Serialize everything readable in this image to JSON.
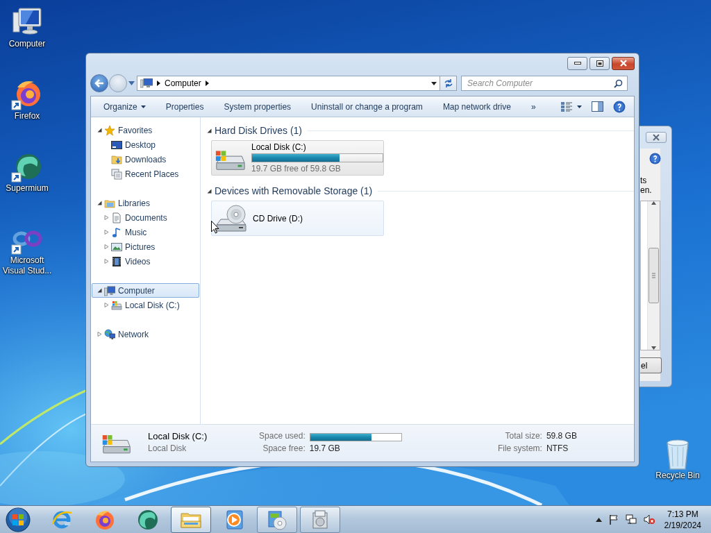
{
  "desktop_icons": [
    {
      "label": "Computer",
      "kind": "computer",
      "shortcut": false
    },
    {
      "label": "Firefox",
      "kind": "firefox",
      "shortcut": true
    },
    {
      "label": "Supermium",
      "kind": "supermium",
      "shortcut": true
    },
    {
      "label": "Microsoft Visual Stud...",
      "kind": "vs",
      "shortcut": true
    }
  ],
  "recycle_bin": {
    "label": "Recycle Bin"
  },
  "background_window": {
    "text_lines": [
      "ts",
      "en."
    ],
    "button": "el"
  },
  "explorer": {
    "address": {
      "crumbs": [
        "Computer"
      ]
    },
    "search": {
      "placeholder": "Search Computer"
    },
    "toolbar": [
      {
        "label": "Organize",
        "dropdown": true
      },
      {
        "label": "Properties",
        "dropdown": false
      },
      {
        "label": "System properties",
        "dropdown": false
      },
      {
        "label": "Uninstall or change a program",
        "dropdown": false
      },
      {
        "label": "Map network drive",
        "dropdown": false
      },
      {
        "label": "»",
        "dropdown": false
      }
    ],
    "sidebar": [
      {
        "label": "Favorites",
        "kind": "star",
        "expanded": true,
        "selected": false,
        "children": [
          {
            "label": "Desktop",
            "kind": "desktop",
            "selected": false
          },
          {
            "label": "Downloads",
            "kind": "downloads",
            "selected": false
          },
          {
            "label": "Recent Places",
            "kind": "recent",
            "selected": false
          }
        ]
      },
      {
        "label": "Libraries",
        "kind": "library",
        "expanded": true,
        "selected": false,
        "children": [
          {
            "label": "Documents",
            "kind": "document",
            "expanded": false,
            "selected": false
          },
          {
            "label": "Music",
            "kind": "music",
            "expanded": false,
            "selected": false
          },
          {
            "label": "Pictures",
            "kind": "pictures",
            "expanded": false,
            "selected": false
          },
          {
            "label": "Videos",
            "kind": "videos",
            "expanded": false,
            "selected": false
          }
        ]
      },
      {
        "label": "Computer",
        "kind": "computer",
        "expanded": true,
        "selected": true,
        "children": [
          {
            "label": "Local Disk (C:)",
            "kind": "drive",
            "expanded": false,
            "selected": false
          }
        ]
      },
      {
        "label": "Network",
        "kind": "network",
        "expanded": false,
        "selected": false
      }
    ],
    "groups": [
      {
        "title": "Hard Disk Drives (1)",
        "expanded": true,
        "items": [
          {
            "name": "Local Disk (C:)",
            "kind": "hdd",
            "selected": true,
            "level": 0.67,
            "detail": "19.7 GB free of 59.8 GB"
          }
        ]
      },
      {
        "title": "Devices with Removable Storage (1)",
        "expanded": true,
        "items": [
          {
            "name": "CD Drive (D:)",
            "kind": "cd",
            "selected": false
          }
        ]
      }
    ],
    "details": {
      "name": "Local Disk (C:)",
      "type": "Local Disk",
      "fields": [
        {
          "label": "Space used:",
          "kind": "bar",
          "level": 0.67
        },
        {
          "label": "Total size:",
          "kind": "text",
          "value": "59.8 GB"
        },
        {
          "label": "Space free:",
          "kind": "text",
          "value": "19.7 GB"
        },
        {
          "label": "File system:",
          "kind": "text",
          "value": "NTFS"
        }
      ]
    }
  },
  "taskbar": {
    "items": [
      {
        "kind": "ie",
        "running": false,
        "active": false
      },
      {
        "kind": "firefox",
        "running": false,
        "active": false
      },
      {
        "kind": "supermium",
        "running": false,
        "active": false
      },
      {
        "kind": "explorer",
        "running": true,
        "active": true
      },
      {
        "kind": "media",
        "running": false,
        "active": false
      },
      {
        "kind": "setup",
        "running": true,
        "active": false
      },
      {
        "kind": "installer",
        "running": true,
        "active": false
      }
    ],
    "clock": {
      "time": "7:13 PM",
      "date": "2/19/2024"
    }
  }
}
